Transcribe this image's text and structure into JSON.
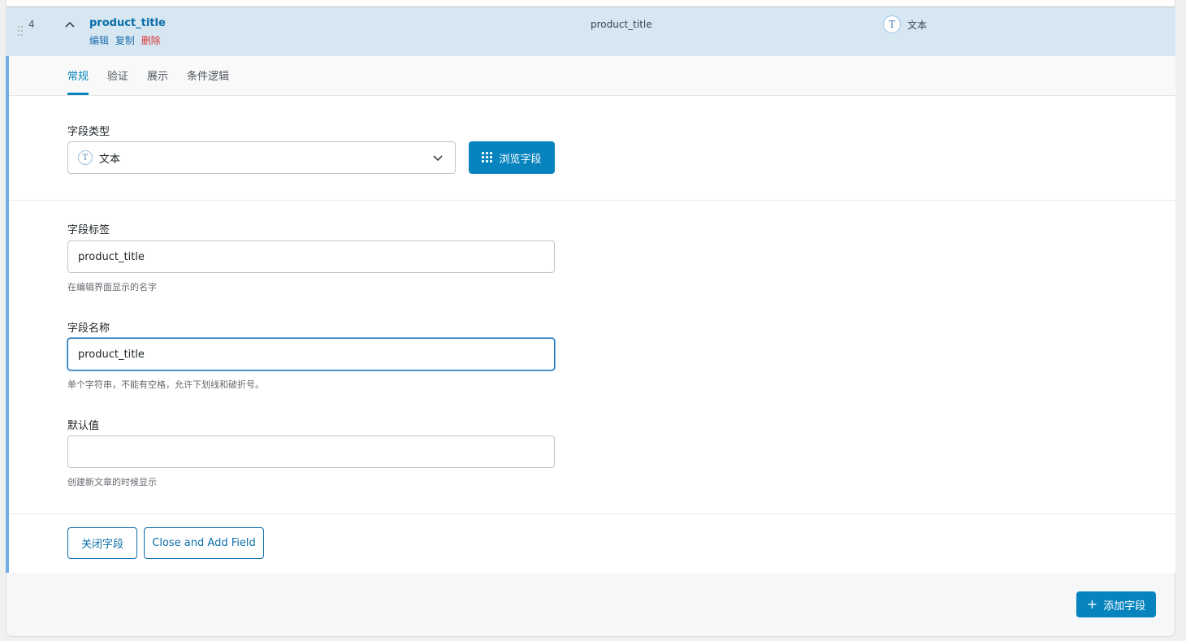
{
  "field_row": {
    "order": "4",
    "title": "product_title",
    "actions": {
      "edit": "编辑",
      "duplicate": "复制",
      "delete": "删除"
    },
    "name": "product_title",
    "type_icon": "T",
    "type_label": "文本"
  },
  "tabs": [
    "常规",
    "验证",
    "展示",
    "条件逻辑"
  ],
  "field_type": {
    "label": "字段类型",
    "selected_icon": "T",
    "selected": "文本",
    "browse_label": "浏览字段"
  },
  "field_label": {
    "label": "字段标签",
    "value": "product_title",
    "hint": "在编辑界面显示的名字"
  },
  "field_name": {
    "label": "字段名称",
    "value": "product_title",
    "hint": "单个字符串，不能有空格，允许下划线和破折号。"
  },
  "default_value": {
    "label": "默认值",
    "value": "",
    "hint": "创建新文章的时候显示"
  },
  "footer": {
    "close_label": "关闭字段",
    "close_add_label": "Close and Add Field"
  },
  "add_field_label": "添加字段",
  "colors": {
    "accent": "#0783be",
    "delete": "#d63638",
    "header_bg": "#d6e7f2"
  }
}
